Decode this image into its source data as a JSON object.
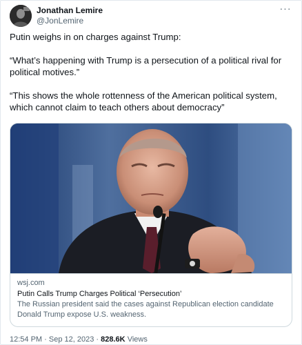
{
  "author": {
    "display_name": "Jonathan Lemire",
    "handle": "@JonLemire",
    "avatar_icon": "profile-photo",
    "more_icon": "more-horizontal-icon"
  },
  "tweet": {
    "paragraph_1": "Putin weighs in on charges against Trump:",
    "paragraph_2": "“What’s happening with Trump is a persecution of a political rival for political motives.”",
    "paragraph_3": "“This shows the whole rottenness of the American political system, which cannot claim to teach others about democracy”"
  },
  "card": {
    "domain": "wsj.com",
    "title": "Putin Calls Trump Charges Political ‘Persecution’",
    "description": "The Russian president said the cases against Republican election candidate Donald Trump expose U.S. weakness.",
    "image_subject": "photo of Vladimir Putin at a microphone"
  },
  "meta": {
    "time": "12:54 PM",
    "separator": "·",
    "date": "Sep 12, 2023",
    "views_count": "828.6K",
    "views_label": "Views"
  },
  "colors": {
    "text_primary": "#0f1419",
    "text_secondary": "#536471",
    "border": "#cfd9de"
  }
}
